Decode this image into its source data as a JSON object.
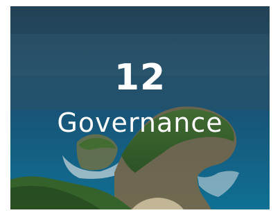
{
  "card": {
    "number": "12",
    "title": "Governance",
    "background_image": "tropical-island-cliff-ocean-photo"
  },
  "colors": {
    "text": "#ffffff",
    "sky": "#2e5f7a",
    "ocean": "#1c6b8f",
    "cliff": "#3f6a2a"
  }
}
